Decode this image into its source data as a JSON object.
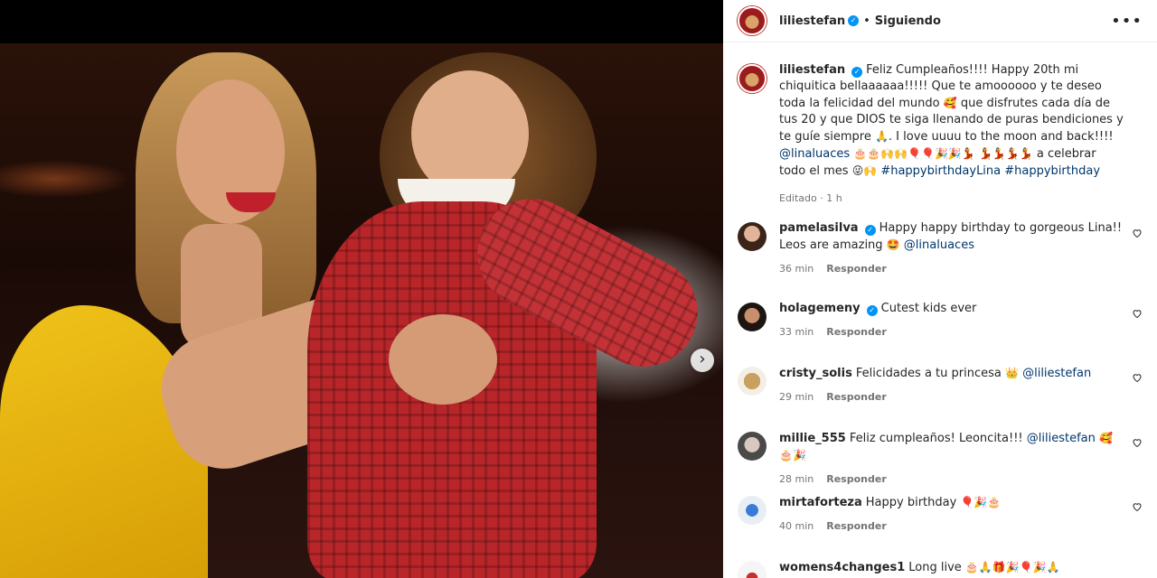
{
  "post": {
    "owner": "liliestefan",
    "separator": "•",
    "follow_status": "Siguiendo",
    "more_label": "•••",
    "next_label": "›",
    "caption": {
      "text_1": "Feliz Cumpleaños!!!! Happy 20th mi chiquitica bellaaaaaa!!!!! Que te amoooooo y te deseo toda la felicidad del mundo",
      "emoji_1": "🥰",
      "text_2": "que disfrutes cada día de tus 20 y que DIOS te siga llenando de puras bendiciones y te guíe siempre",
      "emoji_2": "🙏",
      "text_3": ". I love uuuu to the moon and back!!!!",
      "mention": "@linaluaces",
      "emoji_3": "🎂🎂🙌🙌🎈🎈🎉🎉💃",
      "emoji_4": "💃💃💃💃",
      "text_4": "a celebrar todo el mes",
      "emoji_5": "😜🙌",
      "hashtag_1": "#happybirthdayLina",
      "hashtag_2": "#happybirthday",
      "meta": "Editado · 1 h"
    },
    "comments": [
      {
        "user": "pamelasilva",
        "verified": true,
        "text": "Happy happy birthday to gorgeous Lina!! Leos are amazing",
        "emoji": "🤩",
        "mention": "@linaluaces",
        "time": "36 min",
        "reply": "Responder"
      },
      {
        "user": "holagemeny",
        "verified": true,
        "text": "Cutest kids ever",
        "emoji": "",
        "mention": "",
        "time": "33 min",
        "reply": "Responder"
      },
      {
        "user": "cristy_solis",
        "verified": false,
        "text": "Felicidades a tu princesa",
        "emoji": "👑",
        "mention": "@liliestefan",
        "time": "29 min",
        "reply": "Responder"
      },
      {
        "user": "millie_555",
        "verified": false,
        "text": "Feliz cumpleaños! Leoncita!!!",
        "emoji": "",
        "mention": "@liliestefan",
        "emoji_after": "🥰🎂🎉",
        "time": "28 min",
        "reply": "Responder"
      },
      {
        "user": "mirtaforteza",
        "verified": false,
        "text": "Happy birthday",
        "emoji": "🎈🎉🎂",
        "mention": "",
        "time": "40 min",
        "reply": "Responder"
      },
      {
        "user": "womens4changes1",
        "verified": false,
        "text": "Long live",
        "emoji": "🎂🙏🎁🎉🎈🎉🙏",
        "mention": "",
        "time": "",
        "reply": ""
      }
    ]
  },
  "colors": {
    "accent": "#0095f6",
    "link": "#00376b",
    "muted": "#737373"
  }
}
